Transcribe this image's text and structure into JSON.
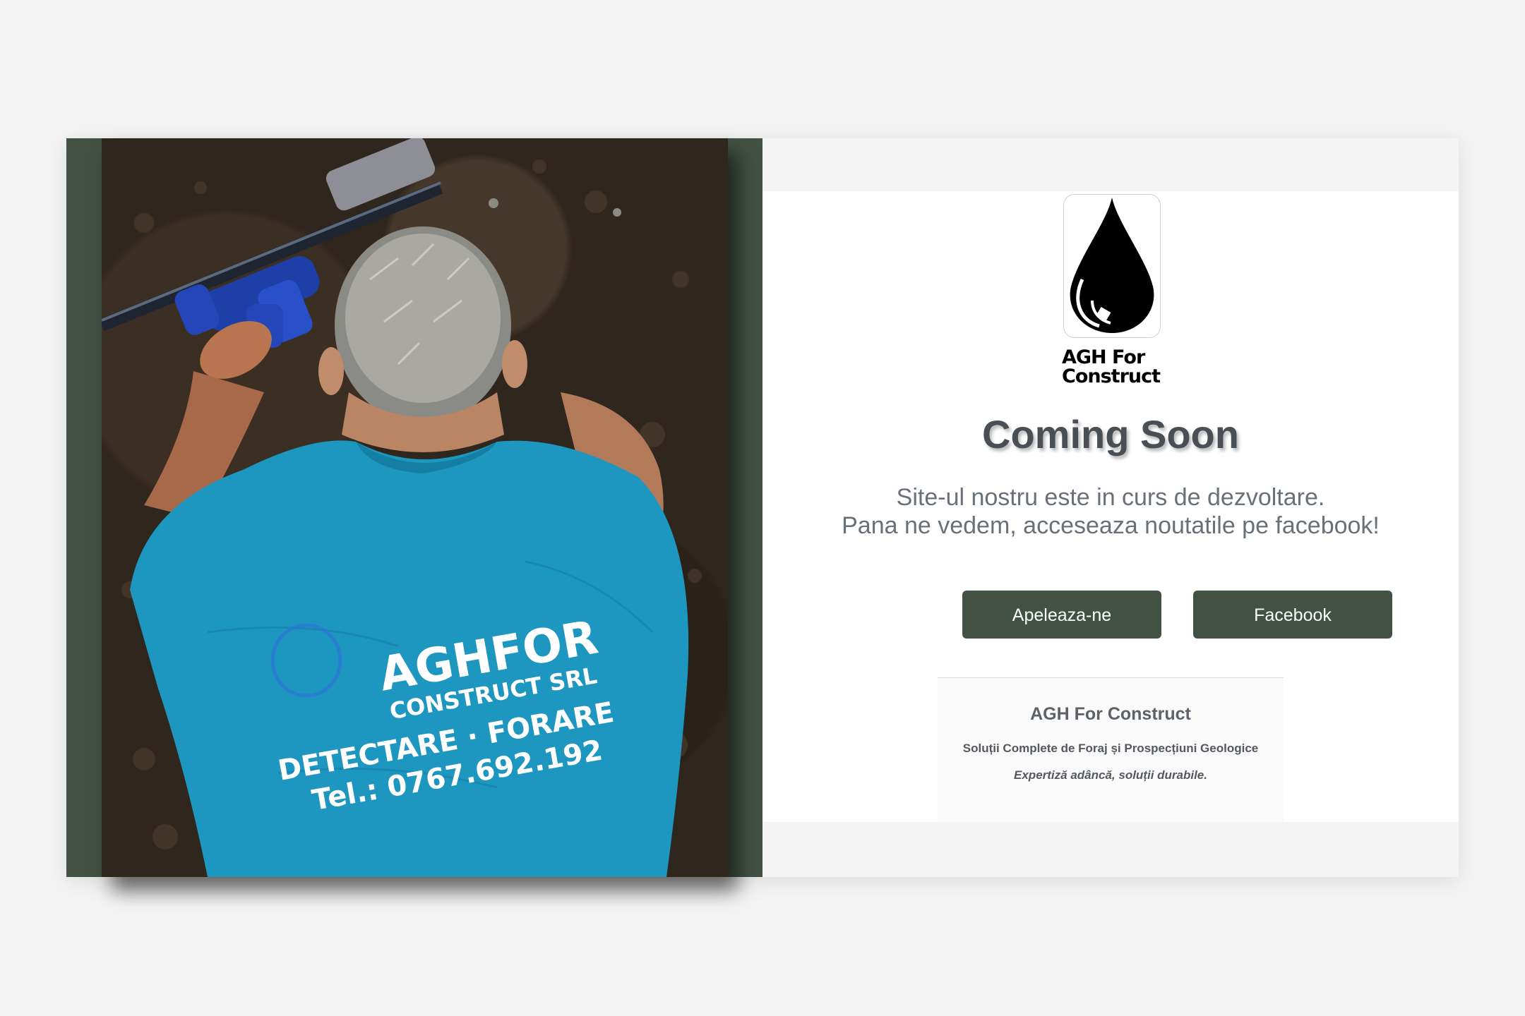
{
  "brand": {
    "logo_line1": "AGH For",
    "logo_line2": "Construct"
  },
  "hero": {
    "title": "Coming Soon",
    "subtitle_line1": "Site-ul nostru este in curs de dezvoltare.",
    "subtitle_line2": "Pana ne vedem, acceseaza noutatile pe facebook!"
  },
  "buttons": {
    "call_label": "Apeleaza-ne",
    "facebook_label": "Facebook"
  },
  "info": {
    "company": "AGH For Construct",
    "tagline": "Soluții Complete de Foraj și Prospecțiuni Geologice",
    "motto": "Expertiză adâncă, soluții durabile."
  },
  "photo": {
    "shirt_line1": "AGHFOR",
    "shirt_line2": "CONSTRUCT SRL",
    "shirt_line3": "DETECTARE · FORARE",
    "shirt_line4": "Tel.: 0767.692.192"
  },
  "colors": {
    "accent": "#415245",
    "background": "#f4f4f4",
    "shirt": "#1e97c0"
  }
}
